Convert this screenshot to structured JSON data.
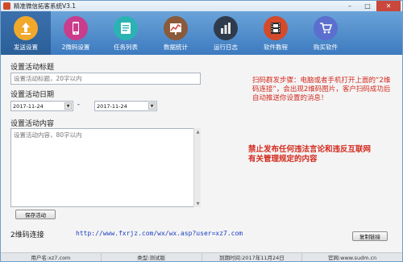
{
  "window": {
    "title": "精准微信拓客系统V3.1",
    "minimize": "–",
    "maximize": "□",
    "close": "✕"
  },
  "toolbar": {
    "items": [
      {
        "label": "发送设置",
        "icon": "upload-icon",
        "active": true
      },
      {
        "label": "2微码设置",
        "icon": "phone-icon",
        "active": false
      },
      {
        "label": "任务列表",
        "icon": "task-list-icon",
        "active": false
      },
      {
        "label": "数据统计",
        "icon": "chart-icon",
        "active": false
      },
      {
        "label": "运行日志",
        "icon": "log-icon",
        "active": false
      },
      {
        "label": "软件教程",
        "icon": "film-icon",
        "active": false
      },
      {
        "label": "购买软件",
        "icon": "cart-icon",
        "active": false
      }
    ]
  },
  "form": {
    "title_label": "设置活动标题",
    "title_placeholder": "设置活动标题，20字以内",
    "date_label": "设置活动日期",
    "start_date": "2017-11-24",
    "end_date": "2017-11-24",
    "date_separator": "-",
    "content_label": "设置活动内容",
    "content_placeholder": "设置活动内容，80字以内",
    "save_button": "保存活动"
  },
  "instructions": "扫码群发步骤：电脑或者手机打开上面的“2维码连接”，会出现2维码图片，客户扫码成功后自动推送你设置的消息！",
  "warning": "禁止发布任何违法言论和违反互联网有关管理规定的内容",
  "link": {
    "label": "2维码连接",
    "url": "http://www.fxrjz.com/wx/wx.asp?user=xz7.com",
    "copy_button": "复制链接"
  },
  "statusbar": {
    "user": "用户名:xz7.com",
    "type": "类型:测试版",
    "expiry": "到期时间:2017年11月24日",
    "website": "官网:www.sudm.cn"
  },
  "colors": {
    "toolbar_bg": "#4a86c7",
    "accent_red": "#d32a1e",
    "link_blue": "#1a3fc0"
  }
}
